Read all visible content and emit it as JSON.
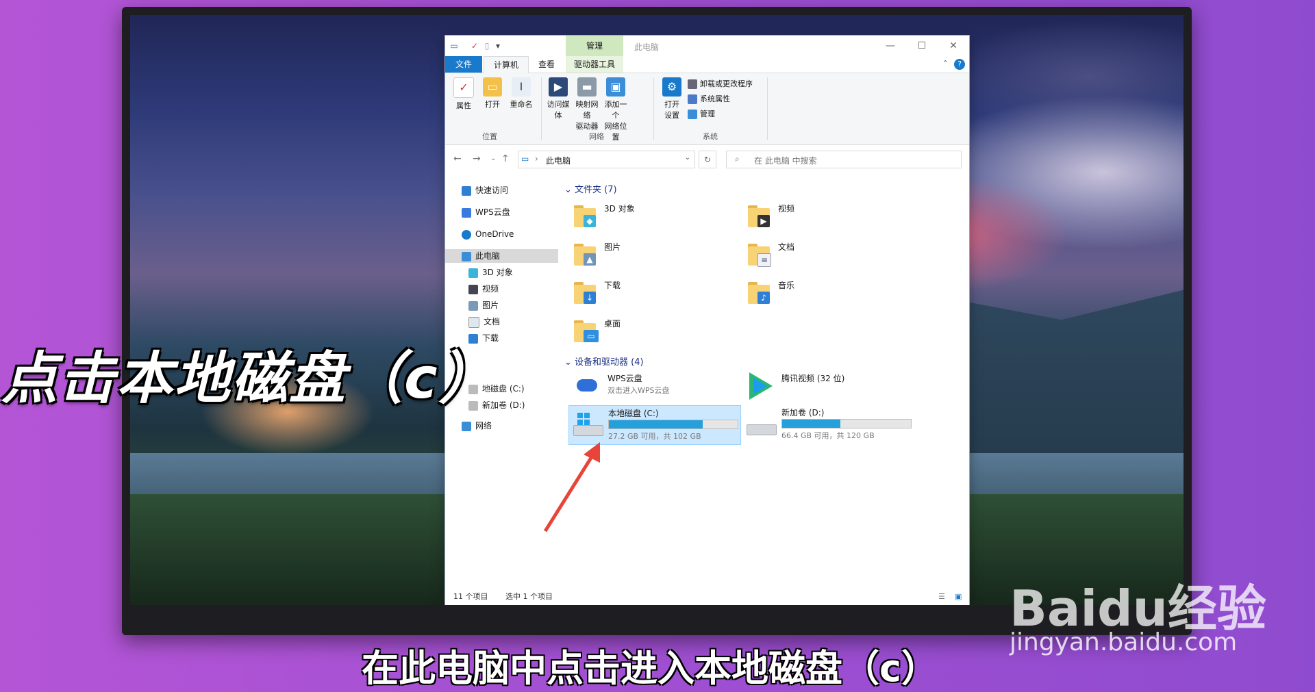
{
  "window": {
    "title": "此电脑",
    "context_tab": "管理",
    "controls": [
      "—",
      "☐",
      "✕"
    ]
  },
  "tabs": [
    "文件",
    "计算机",
    "查看",
    "驱动器工具"
  ],
  "ribbon": {
    "location": {
      "label": "位置",
      "buttons": [
        "属性",
        "打开",
        "重命名"
      ]
    },
    "network": {
      "label": "网络",
      "buttons": [
        {
          "line1": "访问媒体",
          "line2": ""
        },
        {
          "line1": "映射网络",
          "line2": "驱动器"
        },
        {
          "line1": "添加一个",
          "line2": "网络位置"
        }
      ]
    },
    "system": {
      "label": "系统",
      "open_settings": {
        "line1": "打开",
        "line2": "设置"
      },
      "small": [
        "卸载或更改程序",
        "系统属性",
        "管理"
      ]
    }
  },
  "address": {
    "path": "此电脑",
    "search_placeholder": "在 此电脑 中搜索"
  },
  "nav_pane": {
    "items": [
      {
        "label": "快速访问",
        "icon": "star-icon"
      },
      {
        "label": "WPS云盘",
        "icon": "cloud-icon"
      },
      {
        "label": "OneDrive",
        "icon": "onedrive-icon"
      },
      {
        "label": "此电脑",
        "icon": "pc-icon"
      },
      {
        "label": "3D 对象",
        "icon": "3d-icon"
      },
      {
        "label": "视频",
        "icon": "video-icon"
      },
      {
        "label": "图片",
        "icon": "picture-icon"
      },
      {
        "label": "文档",
        "icon": "document-icon"
      },
      {
        "label": "下载",
        "icon": "download-icon"
      },
      {
        "label": "地磁盘 (C:)",
        "icon": "drive-icon"
      },
      {
        "label": "新加卷 (D:)",
        "icon": "drive-icon"
      },
      {
        "label": "网络",
        "icon": "network-icon"
      }
    ]
  },
  "content": {
    "folders_header": "文件夹 (7)",
    "folders": [
      {
        "label": "3D 对象",
        "icon": "3d-object-folder-icon"
      },
      {
        "label": "视频",
        "icon": "video-folder-icon"
      },
      {
        "label": "图片",
        "icon": "picture-folder-icon"
      },
      {
        "label": "文档",
        "icon": "document-folder-icon"
      },
      {
        "label": "下载",
        "icon": "download-folder-icon"
      },
      {
        "label": "音乐",
        "icon": "music-folder-icon"
      },
      {
        "label": "桌面",
        "icon": "desktop-folder-icon"
      }
    ],
    "devices_header": "设备和驱动器 (4)",
    "devices": [
      {
        "label": "WPS云盘",
        "sub": "双击进入WPS云盘",
        "icon": "wps-cloud-icon"
      },
      {
        "label": "腾讯视频 (32 位)",
        "sub": "",
        "icon": "tencent-video-icon"
      },
      {
        "label": "本地磁盘 (C:)",
        "sub": "27.2 GB 可用，共 102 GB",
        "used": 0.73,
        "icon": "windows-drive-icon"
      },
      {
        "label": "新加卷 (D:)",
        "sub": "66.4 GB 可用，共 120 GB",
        "used": 0.45,
        "icon": "drive-icon"
      }
    ]
  },
  "status": {
    "count": "11 个项目",
    "selected": "选中 1 个项目"
  },
  "overlay": {
    "title": "点击本地磁盘（c）",
    "subtitle": "在此电脑中点击进入本地磁盘（c）"
  },
  "watermark": {
    "brand": "Baidu经验",
    "url": "jingyan.baidu.com"
  },
  "colors": {
    "accent": "#1979ca",
    "drive_fill": "#26a0da",
    "selection": "#cce8ff",
    "arrow": "#e8443a"
  }
}
